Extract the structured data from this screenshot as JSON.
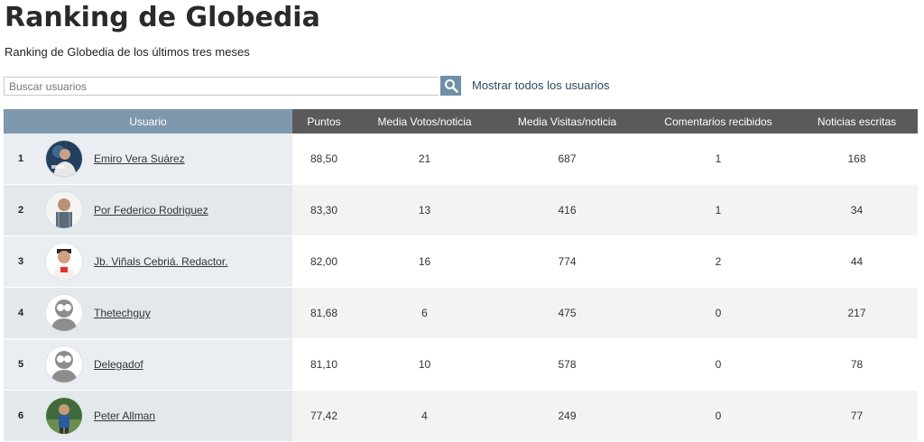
{
  "page": {
    "title": "Ranking de Globedia",
    "subtitle": "Ranking de Globedia de los últimos tres meses"
  },
  "search": {
    "placeholder": "Buscar usuarios",
    "button_icon": "search-icon",
    "show_all_label": "Mostrar todos los usuarios"
  },
  "table": {
    "headers": {
      "user": "Usuario",
      "points": "Puntos",
      "avg_votes": "Media Votos/noticia",
      "avg_visits": "Media Visitas/noticia",
      "comments": "Comentarios recibidos",
      "news": "Noticias escritas"
    },
    "rows": [
      {
        "rank": "1",
        "name": "Emiro Vera Suárez",
        "avatar": "photo",
        "points": "88,50",
        "avg_votes": "21",
        "avg_visits": "687",
        "comments": "1",
        "news": "168"
      },
      {
        "rank": "2",
        "name": "Por Federico Rodriguez",
        "avatar": "photo",
        "points": "83,30",
        "avg_votes": "13",
        "avg_visits": "416",
        "comments": "1",
        "news": "34"
      },
      {
        "rank": "3",
        "name": "Jb. Viñals Cebriá. Redactor.",
        "avatar": "photo",
        "points": "82,00",
        "avg_votes": "16",
        "avg_visits": "774",
        "comments": "2",
        "news": "44"
      },
      {
        "rank": "4",
        "name": "Thetechguy",
        "avatar": "default",
        "points": "81,68",
        "avg_votes": "6",
        "avg_visits": "475",
        "comments": "0",
        "news": "217"
      },
      {
        "rank": "5",
        "name": "Delegadof",
        "avatar": "default",
        "points": "81,10",
        "avg_votes": "10",
        "avg_visits": "578",
        "comments": "0",
        "news": "78"
      },
      {
        "rank": "6",
        "name": "Peter Allman",
        "avatar": "photo",
        "points": "77,42",
        "avg_votes": "4",
        "avg_visits": "249",
        "comments": "0",
        "news": "77"
      }
    ]
  },
  "colors": {
    "header_dark": "#5a5a5a",
    "header_user": "#7f98ad",
    "search_button": "#6f8fa8",
    "link": "#2c4a5e"
  }
}
